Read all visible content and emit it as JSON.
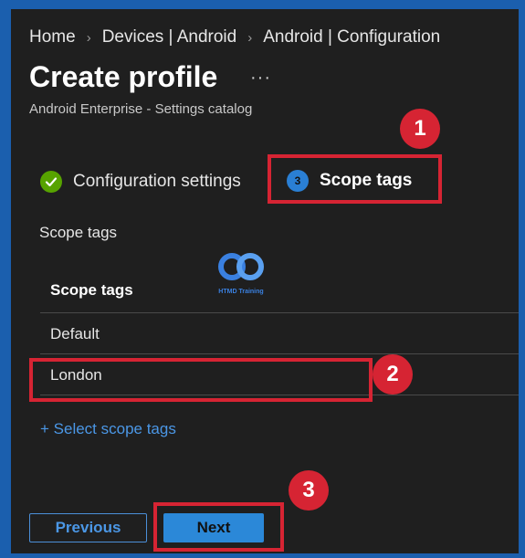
{
  "breadcrumb": {
    "items": [
      "Home",
      "Devices | Android",
      "Android | Configuration"
    ],
    "separator": "›"
  },
  "page": {
    "title": "Create profile",
    "more": "···",
    "subtitle": "Android Enterprise - Settings catalog"
  },
  "steps": [
    {
      "label": "Configuration settings",
      "state": "completed",
      "icon": "check-icon"
    },
    {
      "label": "Scope tags",
      "state": "current",
      "number": "3"
    }
  ],
  "section_label": "Scope tags",
  "logo": {
    "text": "HTMD Training"
  },
  "table": {
    "header": "Scope tags",
    "rows": [
      "Default",
      "London"
    ]
  },
  "select_link": "+ Select scope tags",
  "buttons": {
    "previous": "Previous",
    "next": "Next"
  },
  "annotations": [
    "1",
    "2",
    "3"
  ],
  "colors": {
    "background": "#1f1f1f",
    "accent": "#2b88d8",
    "link": "#4b97e6",
    "success": "#57a300",
    "annotation_red": "#d62433",
    "border_blue": "#1b5fae"
  }
}
